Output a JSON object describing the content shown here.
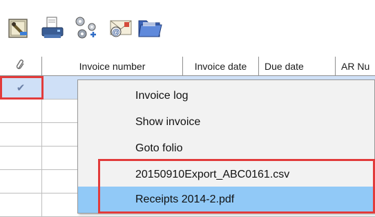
{
  "toolbar": {
    "buttons": [
      {
        "name": "approve-icon"
      },
      {
        "name": "print-icon"
      },
      {
        "name": "workflow-icon"
      },
      {
        "name": "email-icon"
      },
      {
        "name": "folder-icon"
      }
    ]
  },
  "grid": {
    "columns": [
      {
        "label": "",
        "icon": "paperclip-icon"
      },
      {
        "label": "Invoice number"
      },
      {
        "label": "Invoice date"
      },
      {
        "label": "Due date"
      },
      {
        "label": "AR Nu"
      }
    ],
    "selected_row_check": "✔"
  },
  "context_menu": {
    "items": [
      {
        "label": "Invoice log"
      },
      {
        "label": "Show invoice"
      },
      {
        "label": "Goto folio"
      },
      {
        "label": "20150910Export_ABC0161.csv"
      },
      {
        "label": "Receipts 2014-2.pdf"
      }
    ]
  },
  "colors": {
    "highlight_red": "#e23b3b",
    "menu_hover": "#91c9f7",
    "row_selected": "#cfe0f7"
  }
}
